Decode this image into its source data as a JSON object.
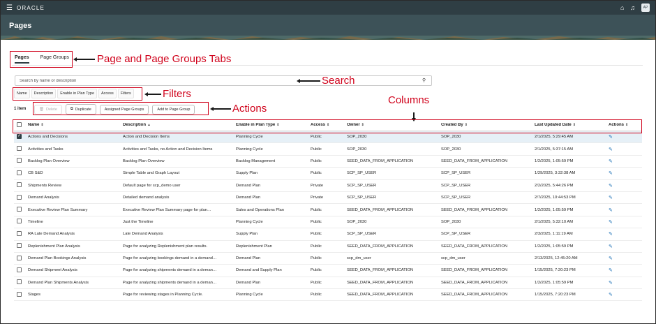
{
  "app": {
    "brand": "ORACLE",
    "avatar": "AP"
  },
  "header": {
    "title": "Pages"
  },
  "tabs": [
    {
      "label": "Pages",
      "active": true
    },
    {
      "label": "Page Groups",
      "active": false
    }
  ],
  "search": {
    "placeholder": "Search by name or description"
  },
  "filters": [
    "Name",
    "Description",
    "Enable in Plan Type",
    "Access",
    "Filters"
  ],
  "item_count": "1 item",
  "actions": {
    "delete": "Delete",
    "duplicate": "Duplicate",
    "assigned": "Assigned Page Groups",
    "add": "Add to Page Group"
  },
  "annotations": {
    "tabs": "Page and Page Groups Tabs",
    "search": "Search",
    "filters": "Filters",
    "actions": "Actions",
    "columns": "Columns"
  },
  "table": {
    "columns": [
      {
        "label": "Name",
        "sort": "⇕"
      },
      {
        "label": "Description",
        "sort": "▲"
      },
      {
        "label": "Enable in Plan Type",
        "sort": "⇕"
      },
      {
        "label": "Access",
        "sort": "⇕"
      },
      {
        "label": "Owner",
        "sort": "⇕"
      },
      {
        "label": "Created By",
        "sort": "⇕"
      },
      {
        "label": "Last Updated Date",
        "sort": "⇕"
      },
      {
        "label": "Actions",
        "sort": "⇕"
      }
    ],
    "rows": [
      {
        "selected": true,
        "name": "Actions and Decisions",
        "description": "Action and Decision Items",
        "plan": "Planning Cycle",
        "access": "Public",
        "owner": "SOP_2030",
        "created": "SOP_2030",
        "date": "2/1/2025, 5:29:45 AM"
      },
      {
        "selected": false,
        "name": "Activities and Tasks",
        "description": "Activities and Tasks, no Action and Decision Items",
        "plan": "Planning Cycle",
        "access": "Public",
        "owner": "SOP_2030",
        "created": "SOP_2030",
        "date": "2/1/2025, 5:37:15 AM"
      },
      {
        "selected": false,
        "name": "Backlog Plan Overview",
        "description": "Backlog Plan Overview",
        "plan": "Backlog Management",
        "access": "Public",
        "owner": "SEED_DATA_FROM_APPLICATION",
        "created": "SEED_DATA_FROM_APPLICATION",
        "date": "1/2/2025, 1:05:59 PM"
      },
      {
        "selected": false,
        "name": "CB S&D",
        "description": "Simple Table and Graph Layout",
        "plan": "Supply Plan",
        "access": "Public",
        "owner": "SCP_SP_USER",
        "created": "SCP_SP_USER",
        "date": "1/29/2025, 3:32:38 AM"
      },
      {
        "selected": false,
        "name": "Shipments Review",
        "description": "Default page for scp_demo user",
        "plan": "Demand Plan",
        "access": "Private",
        "owner": "SCP_SP_USER",
        "created": "SCP_SP_USER",
        "date": "2/2/2025, 5:44:26 PM"
      },
      {
        "selected": false,
        "name": "Demand Analysis",
        "description": "Detailed demand analysis",
        "plan": "Demand Plan",
        "access": "Private",
        "owner": "SCP_SP_USER",
        "created": "SCP_SP_USER",
        "date": "2/7/2025, 10:44:53 PM"
      },
      {
        "selected": false,
        "name": "Executive Review Plan Summary",
        "description": "Executive Review Plan Summary page for plan…",
        "plan": "Sales and Operations Plan",
        "access": "Public",
        "owner": "SEED_DATA_FROM_APPLICATION",
        "created": "SEED_DATA_FROM_APPLICATION",
        "date": "1/2/2025, 1:05:59 PM"
      },
      {
        "selected": false,
        "name": "Timeline",
        "description": "Just the Timeline",
        "plan": "Planning Cycle",
        "access": "Public",
        "owner": "SOP_2030",
        "created": "SOP_2030",
        "date": "2/1/2025, 5:32:10 AM"
      },
      {
        "selected": false,
        "name": "RA Late Demand Analysis",
        "description": "Late Demand Analysis",
        "plan": "Supply Plan",
        "access": "Public",
        "owner": "SCP_SP_USER",
        "created": "SCP_SP_USER",
        "date": "2/3/2025, 1:11:19 AM"
      },
      {
        "selected": false,
        "name": "Replenishment Plan Analysis",
        "description": "Page for analyzing Replenishment plan results.",
        "plan": "Replenishment Plan",
        "access": "Public",
        "owner": "SEED_DATA_FROM_APPLICATION",
        "created": "SEED_DATA_FROM_APPLICATION",
        "date": "1/2/2025, 1:05:59 PM"
      },
      {
        "selected": false,
        "name": "Demand Plan Bookings Analysis",
        "description": "Page for analyzing bookings demand in a demand…",
        "plan": "Demand Plan",
        "access": "Public",
        "owner": "scp_dm_user",
        "created": "scp_dm_user",
        "date": "2/13/2025, 12:45:20 AM"
      },
      {
        "selected": false,
        "name": "Demand Shipment Analysis",
        "description": "Page for analyzing shipments demand in a deman…",
        "plan": "Demand and Supply Plan",
        "access": "Public",
        "owner": "SEED_DATA_FROM_APPLICATION",
        "created": "SEED_DATA_FROM_APPLICATION",
        "date": "1/15/2025, 7:20:23 PM"
      },
      {
        "selected": false,
        "name": "Demand Plan Shipments Analysis",
        "description": "Page for analyzing shipments demand in a deman…",
        "plan": "Demand Plan",
        "access": "Public",
        "owner": "SEED_DATA_FROM_APPLICATION",
        "created": "SEED_DATA_FROM_APPLICATION",
        "date": "1/2/2025, 1:05:59 PM"
      },
      {
        "selected": false,
        "name": "Stages",
        "description": "Page for reviewing stages in Planning Cycle.",
        "plan": "Planning Cycle",
        "access": "Public",
        "owner": "SEED_DATA_FROM_APPLICATION",
        "created": "SEED_DATA_FROM_APPLICATION",
        "date": "1/15/2025, 7:20:23 PM"
      }
    ]
  },
  "colors": {
    "topbar": "#2f3e44",
    "header": "#3d5258",
    "annotation": "#d0021b",
    "edit_icon": "#1a6fb5"
  },
  "icons": {
    "menu": "hamburger-icon",
    "home": "home-icon",
    "notifications": "bell-icon",
    "search": "search-icon",
    "duplicate": "duplicate-icon",
    "delete": "delete-icon",
    "edit": "pencil-icon"
  }
}
